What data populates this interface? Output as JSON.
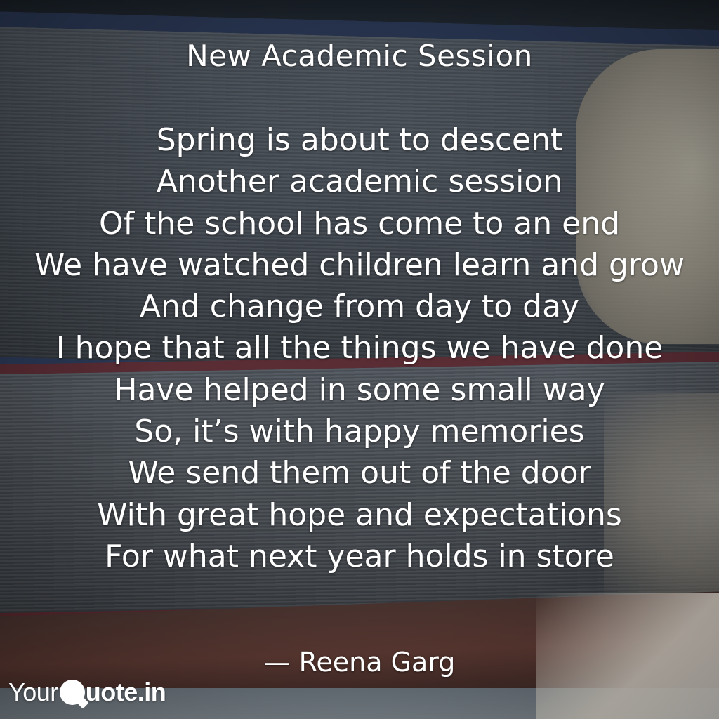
{
  "poem": {
    "title": "New Academic Session",
    "lines": [
      "Spring is about to descent",
      "Another academic session",
      "Of the school has come to an end",
      "We have watched children learn and grow",
      "And change from day to day",
      "I hope that all the things we have done",
      "Have helped in some small way",
      "So, it’s with happy memories",
      "We send them out of the door",
      "With great hope and expectations",
      "For what next year holds in store"
    ],
    "author": "— Reena Garg"
  },
  "brand": {
    "prefix": "Your",
    "icon": "quote-bubble-icon",
    "suffix": "uote.in"
  },
  "background": {
    "subject": "stack-of-old-books",
    "colors": [
      "#2c3a58",
      "#5a2c34",
      "#c8c2b2",
      "#ffffff"
    ]
  }
}
